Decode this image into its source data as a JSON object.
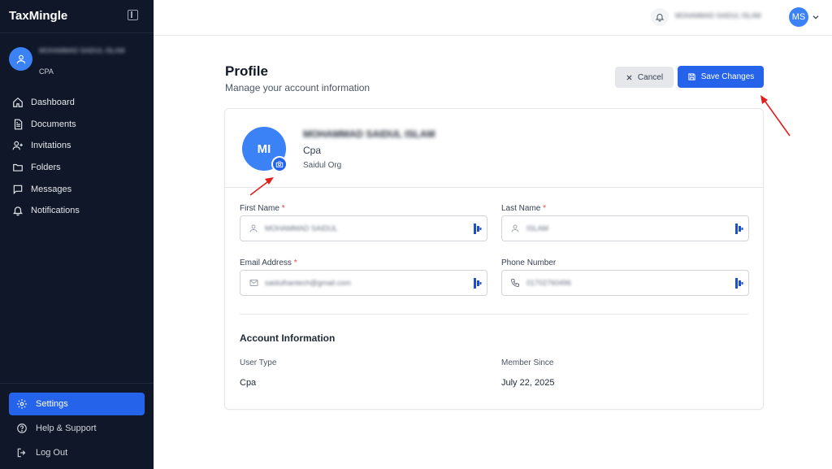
{
  "sidebar": {
    "brand": "TaxMingle",
    "user": {
      "name": "MOHAMMAD SAIDUL ISLAM",
      "role": "CPA"
    },
    "nav": [
      {
        "label": "Dashboard",
        "icon": "home-icon"
      },
      {
        "label": "Documents",
        "icon": "document-icon"
      },
      {
        "label": "Invitations",
        "icon": "user-plus-icon"
      },
      {
        "label": "Folders",
        "icon": "folder-icon"
      },
      {
        "label": "Messages",
        "icon": "message-icon"
      },
      {
        "label": "Notifications",
        "icon": "bell-icon"
      }
    ],
    "bottom_nav": [
      {
        "label": "Settings",
        "icon": "gear-icon",
        "active": true
      },
      {
        "label": "Help & Support",
        "icon": "help-icon"
      },
      {
        "label": "Log Out",
        "icon": "logout-icon"
      }
    ]
  },
  "topbar": {
    "user_name": "MOHAMMAD SAIDUL ISLAM",
    "avatar_initials": "MS"
  },
  "page": {
    "title": "Profile",
    "subtitle": "Manage your account information",
    "cancel_label": "Cancel",
    "save_label": "Save Changes"
  },
  "profile": {
    "initials": "MI",
    "name": "MOHAMMAD SAIDUL ISLAM",
    "role": "Cpa",
    "org": "Saidul Org"
  },
  "form": {
    "first_name": {
      "label": "First Name",
      "value": "MOHAMMAD SAIDUL"
    },
    "last_name": {
      "label": "Last Name",
      "value": "ISLAM"
    },
    "email": {
      "label": "Email Address",
      "value": "saidulhantech@gmail.com"
    },
    "phone": {
      "label": "Phone Number",
      "value": "01702760496"
    },
    "required_mark": "*"
  },
  "account_info": {
    "title": "Account Information",
    "user_type_label": "User Type",
    "user_type_value": "Cpa",
    "member_since_label": "Member Since",
    "member_since_value": "July 22, 2025"
  },
  "colors": {
    "sidebar_bg": "#0f1729",
    "primary": "#2563eb",
    "avatar": "#3b82f6",
    "annotation_arrow": "#e11d1d",
    "required": "#ef4444"
  }
}
